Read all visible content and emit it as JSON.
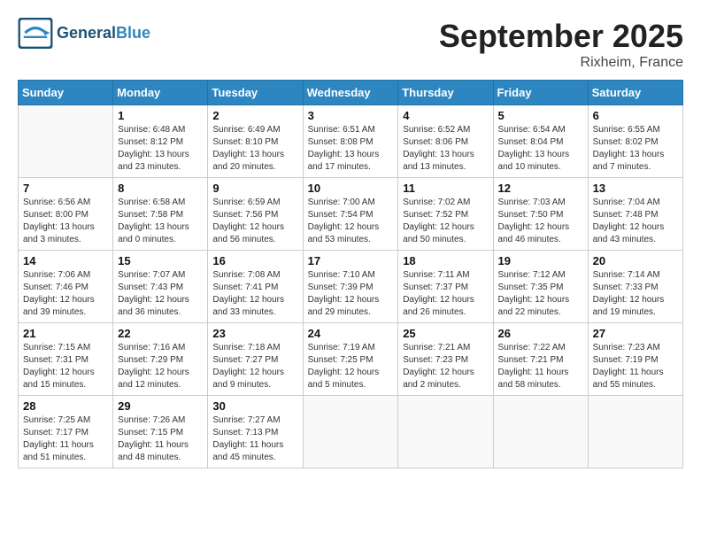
{
  "logo": {
    "general": "General",
    "blue": "Blue"
  },
  "title": "September 2025",
  "location": "Rixheim, France",
  "weekdays": [
    "Sunday",
    "Monday",
    "Tuesday",
    "Wednesday",
    "Thursday",
    "Friday",
    "Saturday"
  ],
  "weeks": [
    [
      {
        "day": "",
        "info": ""
      },
      {
        "day": "1",
        "info": "Sunrise: 6:48 AM\nSunset: 8:12 PM\nDaylight: 13 hours\nand 23 minutes."
      },
      {
        "day": "2",
        "info": "Sunrise: 6:49 AM\nSunset: 8:10 PM\nDaylight: 13 hours\nand 20 minutes."
      },
      {
        "day": "3",
        "info": "Sunrise: 6:51 AM\nSunset: 8:08 PM\nDaylight: 13 hours\nand 17 minutes."
      },
      {
        "day": "4",
        "info": "Sunrise: 6:52 AM\nSunset: 8:06 PM\nDaylight: 13 hours\nand 13 minutes."
      },
      {
        "day": "5",
        "info": "Sunrise: 6:54 AM\nSunset: 8:04 PM\nDaylight: 13 hours\nand 10 minutes."
      },
      {
        "day": "6",
        "info": "Sunrise: 6:55 AM\nSunset: 8:02 PM\nDaylight: 13 hours\nand 7 minutes."
      }
    ],
    [
      {
        "day": "7",
        "info": "Sunrise: 6:56 AM\nSunset: 8:00 PM\nDaylight: 13 hours\nand 3 minutes."
      },
      {
        "day": "8",
        "info": "Sunrise: 6:58 AM\nSunset: 7:58 PM\nDaylight: 13 hours\nand 0 minutes."
      },
      {
        "day": "9",
        "info": "Sunrise: 6:59 AM\nSunset: 7:56 PM\nDaylight: 12 hours\nand 56 minutes."
      },
      {
        "day": "10",
        "info": "Sunrise: 7:00 AM\nSunset: 7:54 PM\nDaylight: 12 hours\nand 53 minutes."
      },
      {
        "day": "11",
        "info": "Sunrise: 7:02 AM\nSunset: 7:52 PM\nDaylight: 12 hours\nand 50 minutes."
      },
      {
        "day": "12",
        "info": "Sunrise: 7:03 AM\nSunset: 7:50 PM\nDaylight: 12 hours\nand 46 minutes."
      },
      {
        "day": "13",
        "info": "Sunrise: 7:04 AM\nSunset: 7:48 PM\nDaylight: 12 hours\nand 43 minutes."
      }
    ],
    [
      {
        "day": "14",
        "info": "Sunrise: 7:06 AM\nSunset: 7:46 PM\nDaylight: 12 hours\nand 39 minutes."
      },
      {
        "day": "15",
        "info": "Sunrise: 7:07 AM\nSunset: 7:43 PM\nDaylight: 12 hours\nand 36 minutes."
      },
      {
        "day": "16",
        "info": "Sunrise: 7:08 AM\nSunset: 7:41 PM\nDaylight: 12 hours\nand 33 minutes."
      },
      {
        "day": "17",
        "info": "Sunrise: 7:10 AM\nSunset: 7:39 PM\nDaylight: 12 hours\nand 29 minutes."
      },
      {
        "day": "18",
        "info": "Sunrise: 7:11 AM\nSunset: 7:37 PM\nDaylight: 12 hours\nand 26 minutes."
      },
      {
        "day": "19",
        "info": "Sunrise: 7:12 AM\nSunset: 7:35 PM\nDaylight: 12 hours\nand 22 minutes."
      },
      {
        "day": "20",
        "info": "Sunrise: 7:14 AM\nSunset: 7:33 PM\nDaylight: 12 hours\nand 19 minutes."
      }
    ],
    [
      {
        "day": "21",
        "info": "Sunrise: 7:15 AM\nSunset: 7:31 PM\nDaylight: 12 hours\nand 15 minutes."
      },
      {
        "day": "22",
        "info": "Sunrise: 7:16 AM\nSunset: 7:29 PM\nDaylight: 12 hours\nand 12 minutes."
      },
      {
        "day": "23",
        "info": "Sunrise: 7:18 AM\nSunset: 7:27 PM\nDaylight: 12 hours\nand 9 minutes."
      },
      {
        "day": "24",
        "info": "Sunrise: 7:19 AM\nSunset: 7:25 PM\nDaylight: 12 hours\nand 5 minutes."
      },
      {
        "day": "25",
        "info": "Sunrise: 7:21 AM\nSunset: 7:23 PM\nDaylight: 12 hours\nand 2 minutes."
      },
      {
        "day": "26",
        "info": "Sunrise: 7:22 AM\nSunset: 7:21 PM\nDaylight: 11 hours\nand 58 minutes."
      },
      {
        "day": "27",
        "info": "Sunrise: 7:23 AM\nSunset: 7:19 PM\nDaylight: 11 hours\nand 55 minutes."
      }
    ],
    [
      {
        "day": "28",
        "info": "Sunrise: 7:25 AM\nSunset: 7:17 PM\nDaylight: 11 hours\nand 51 minutes."
      },
      {
        "day": "29",
        "info": "Sunrise: 7:26 AM\nSunset: 7:15 PM\nDaylight: 11 hours\nand 48 minutes."
      },
      {
        "day": "30",
        "info": "Sunrise: 7:27 AM\nSunset: 7:13 PM\nDaylight: 11 hours\nand 45 minutes."
      },
      {
        "day": "",
        "info": ""
      },
      {
        "day": "",
        "info": ""
      },
      {
        "day": "",
        "info": ""
      },
      {
        "day": "",
        "info": ""
      }
    ]
  ]
}
